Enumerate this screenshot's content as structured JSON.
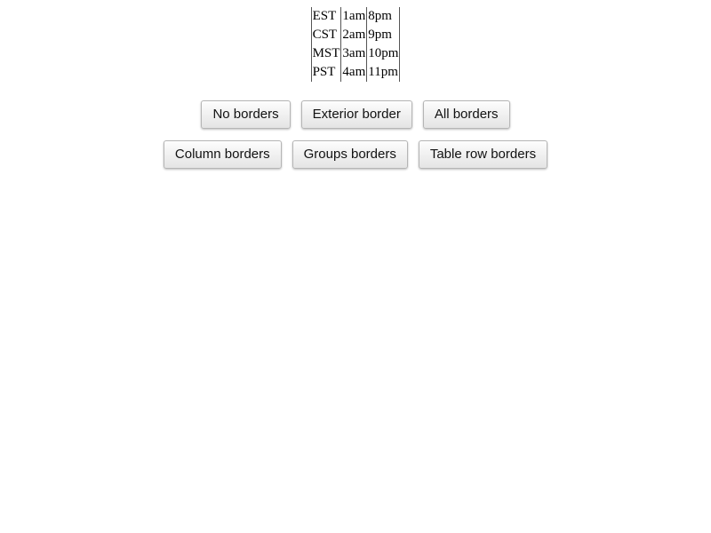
{
  "table": {
    "rows": [
      [
        "EST",
        "1am",
        "8pm"
      ],
      [
        "CST",
        "2am",
        "9pm"
      ],
      [
        "MST",
        "3am",
        "10pm"
      ],
      [
        "PST",
        "4am",
        "11pm"
      ]
    ]
  },
  "buttons": {
    "row1": [
      "No borders",
      "Exterior border",
      "All borders"
    ],
    "row2": [
      "Column borders",
      "Groups borders",
      "Table row borders"
    ]
  }
}
